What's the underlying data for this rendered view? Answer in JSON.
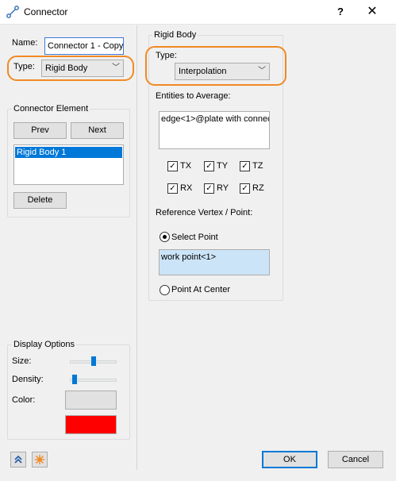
{
  "window": {
    "title": "Connector",
    "help": "?",
    "close": "✕"
  },
  "left": {
    "name_label": "Name:",
    "name_value": "Connector 1 - Copy",
    "type_label": "Type:",
    "type_value": "Rigid Body",
    "connector_element": {
      "title": "Connector Element",
      "prev_label": "Prev",
      "next_label": "Next",
      "items": [
        "Rigid Body 1"
      ],
      "delete_label": "Delete"
    },
    "display_options": {
      "title": "Display Options",
      "size_label": "Size:",
      "size_value": 0.5,
      "density_label": "Density:",
      "density_value": 0.05,
      "color_label": "Color:",
      "color_swatch": "#ff0000"
    }
  },
  "right": {
    "group_title": "Rigid Body",
    "type_label": "Type:",
    "type_value": "Interpolation",
    "entities_label": "Entities to Average:",
    "entities_value": "edge<1>@plate with connec",
    "checkboxes": [
      {
        "label": "TX",
        "checked": true
      },
      {
        "label": "TY",
        "checked": true
      },
      {
        "label": "TZ",
        "checked": true
      },
      {
        "label": "RX",
        "checked": true
      },
      {
        "label": "RY",
        "checked": true
      },
      {
        "label": "RZ",
        "checked": true
      }
    ],
    "reference_label": "Reference Vertex / Point:",
    "select_point_label": "Select Point",
    "select_point_selected": true,
    "point_value": "work point<1>",
    "point_at_center_label": "Point At Center"
  },
  "footer": {
    "ok_label": "OK",
    "cancel_label": "Cancel"
  },
  "colors": {
    "accent": "#0078d7",
    "highlight": "#f08a24",
    "point_field": "#cce4f7"
  }
}
